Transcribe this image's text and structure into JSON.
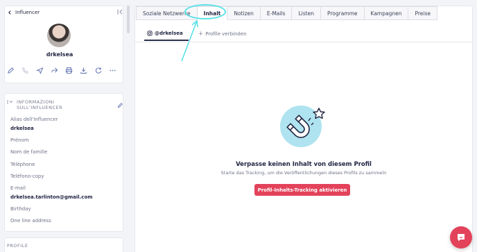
{
  "sidebar": {
    "back_label": "Influencer",
    "username": "drkelsea",
    "section_title": "INFORMAZIONI SULL'INFLUENCER",
    "fields": [
      {
        "label": "Alias dell'influencer",
        "value": "drkelsea"
      },
      {
        "label": "Prénom",
        "value": ""
      },
      {
        "label": "Nom de famille",
        "value": ""
      },
      {
        "label": "Téléphone",
        "value": ""
      },
      {
        "label": "Teléfono-copy",
        "value": ""
      },
      {
        "label": "E-mail",
        "value": "drkelsea.tarlinton@gmail.com"
      },
      {
        "label": "Birthday",
        "value": ""
      },
      {
        "label": "One line address",
        "value": ""
      }
    ],
    "profile_section_title": "PROFILE"
  },
  "tabs": [
    "Soziale Netzwerke",
    "Inhalt",
    "Notizen",
    "E-Mails",
    "Listen",
    "Programme",
    "Kampagnen",
    "Preise"
  ],
  "active_tab": "Inhalt",
  "sub_tabs": {
    "active": "@drkelsea",
    "add": "Profile verbinden"
  },
  "empty_state": {
    "title": "Verpasse keinen Inhalt von diesem Profil",
    "subtitle": "Starte das Tracking, um die Veröffentlichungen dieses Profils zu sammeln",
    "cta_label": "Profil-Inhalts-Tracking aktivieren"
  },
  "colors": {
    "accent": "#e3425b",
    "highlight": "#58e1e6",
    "illustration_bg": "#aee3ef"
  }
}
